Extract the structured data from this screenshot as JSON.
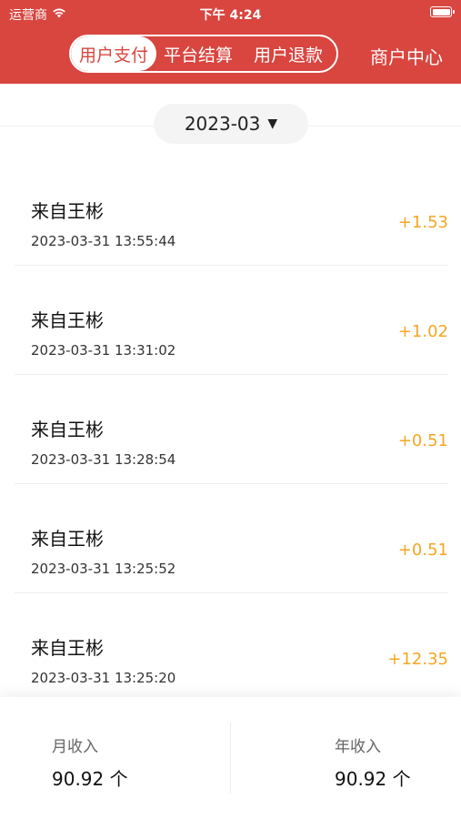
{
  "status_bar": {
    "carrier": "运营商",
    "time": "下午 4:24"
  },
  "header": {
    "tabs": [
      {
        "label": "用户支付",
        "active": true
      },
      {
        "label": "平台结算",
        "active": false
      },
      {
        "label": "用户退款",
        "active": false
      }
    ],
    "merchant_center": "商户中心",
    "color": "#d9453f"
  },
  "month_picker": {
    "value": "2023-03"
  },
  "transactions": [
    {
      "title": "来自王彬",
      "time": "2023-03-31 13:55:44",
      "amount": "+1.53"
    },
    {
      "title": "来自王彬",
      "time": "2023-03-31 13:31:02",
      "amount": "+1.02"
    },
    {
      "title": "来自王彬",
      "time": "2023-03-31 13:28:54",
      "amount": "+0.51"
    },
    {
      "title": "来自王彬",
      "time": "2023-03-31 13:25:52",
      "amount": "+0.51"
    },
    {
      "title": "来自王彬",
      "time": "2023-03-31 13:25:20",
      "amount": "+12.35"
    }
  ],
  "footer": {
    "monthly_label": "月收入",
    "monthly_value": "90.92 个",
    "yearly_label": "年收入",
    "yearly_value": "90.92 个"
  },
  "colors": {
    "accent": "#d9453f",
    "amount": "#f5a623"
  }
}
